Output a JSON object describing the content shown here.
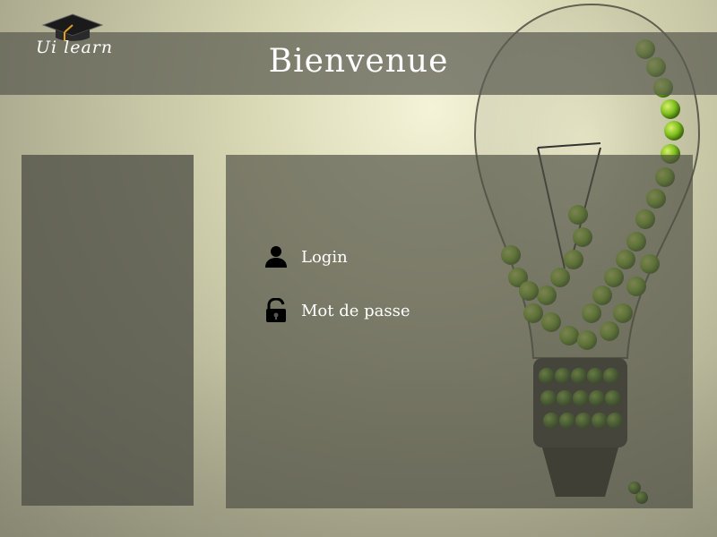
{
  "header": {
    "logo_text": "Ui learn",
    "title": "Bienvenue"
  },
  "form": {
    "login_label": "Login",
    "password_label": "Mot de passe"
  },
  "icons": {
    "logo": "graduation-cap-icon",
    "login": "user-icon",
    "password": "unlock-icon"
  },
  "colors": {
    "header_bg": "#5a5a50",
    "panel_bg": "#505046",
    "text": "#ffffff",
    "accent_apple": "#7fbf1f"
  }
}
